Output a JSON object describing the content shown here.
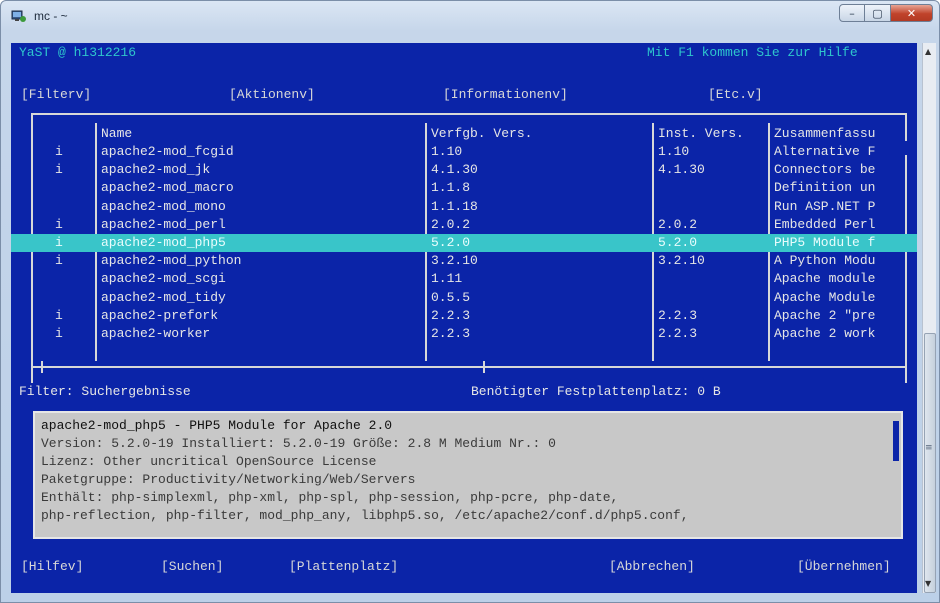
{
  "window": {
    "title": "mc - ~",
    "minimize": "–",
    "maximize": "▢",
    "close": "✕"
  },
  "header": {
    "left": "YaST @ h1312216",
    "right": "Mit F1 kommen Sie zur Hilfe"
  },
  "menu": {
    "filter": "[Filterv]",
    "actions": "[Aktionenv]",
    "information": "[Informationenv]",
    "etc": "[Etc.v]"
  },
  "table": {
    "columns": {
      "name": "Name",
      "available": "Verfgb. Vers.",
      "installed": "Inst. Vers.",
      "summary": "Zusammenfassu"
    },
    "rows": [
      {
        "status": "i",
        "name": "apache2-mod_fcgid",
        "available": "1.10",
        "installed": "1.10",
        "summary": "Alternative F"
      },
      {
        "status": "i",
        "name": "apache2-mod_jk",
        "available": "4.1.30",
        "installed": "4.1.30",
        "summary": "Connectors be"
      },
      {
        "status": "",
        "name": "apache2-mod_macro",
        "available": "1.1.8",
        "installed": "",
        "summary": "Definition un"
      },
      {
        "status": "",
        "name": "apache2-mod_mono",
        "available": "1.1.18",
        "installed": "",
        "summary": "Run ASP.NET P"
      },
      {
        "status": "i",
        "name": "apache2-mod_perl",
        "available": "2.0.2",
        "installed": "2.0.2",
        "summary": "Embedded Perl"
      },
      {
        "status": "i",
        "name": "apache2-mod_php5",
        "available": "5.2.0",
        "installed": "5.2.0",
        "summary": "PHP5 Module f",
        "selected": true
      },
      {
        "status": "i",
        "name": "apache2-mod_python",
        "available": "3.2.10",
        "installed": "3.2.10",
        "summary": "A Python Modu"
      },
      {
        "status": "",
        "name": "apache2-mod_scgi",
        "available": "1.11",
        "installed": "",
        "summary": "Apache module"
      },
      {
        "status": "",
        "name": "apache2-mod_tidy",
        "available": "0.5.5",
        "installed": "",
        "summary": "Apache Module"
      },
      {
        "status": "i",
        "name": "apache2-prefork",
        "available": "2.2.3",
        "installed": "2.2.3",
        "summary": "Apache 2 \"pre"
      },
      {
        "status": "i",
        "name": "apache2-worker",
        "available": "2.2.3",
        "installed": "2.2.3",
        "summary": "Apache 2 work"
      }
    ]
  },
  "status": {
    "filter": "Filter: Suchergebnisse",
    "disk": "Benötigter Festplattenplatz: 0 B"
  },
  "info": {
    "lines": [
      "apache2-mod_php5 - PHP5 Module for Apache 2.0",
      "Version: 5.2.0-19 Installiert: 5.2.0-19 Größe: 2.8 M Medium Nr.: 0",
      "Lizenz: Other uncritical OpenSource License",
      "Paketgruppe: Productivity/Networking/Web/Servers",
      "Enthält: php-simplexml, php-xml, php-spl, php-session, php-pcre, php-date,",
      "php-reflection, php-filter, mod_php_any, libphp5.so, /etc/apache2/conf.d/php5.conf,"
    ]
  },
  "buttons": {
    "help": "[Hilfev]",
    "search": "[Suchen]",
    "disk_space": "[Plattenplatz]",
    "cancel": "[Abbrechen]",
    "accept": "[Übernehmen]"
  },
  "colors": {
    "terminal_bg": "#0b24a8",
    "header_text": "#2ec6cc",
    "selection": "#39c5c9",
    "info_panel": "#c8c8c8"
  }
}
